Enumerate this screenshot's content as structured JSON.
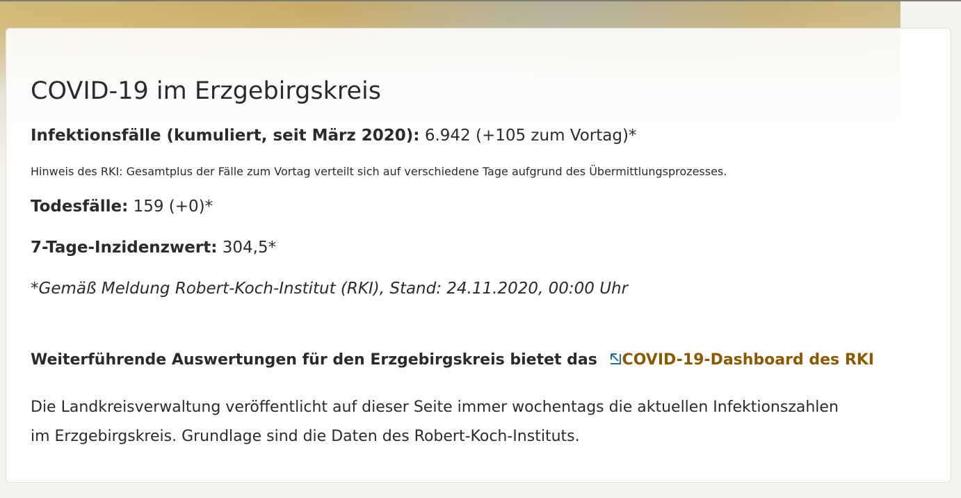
{
  "heading": "COVID-19 im Erzgebirgskreis",
  "infections": {
    "label": "Infektionsfälle (kumuliert, seit März 2020):",
    "value": "6.942 (+105 zum Vortag)*"
  },
  "rki_note": "Hinweis des RKI: Gesamtplus der Fälle zum Vortag verteilt sich auf verschiedene Tage aufgrund des Übermittlungsprozesses.",
  "deaths": {
    "label": "Todesfälle:",
    "value": "159 (+0)*"
  },
  "incidence": {
    "label": "7-Tage-Inzidenzwert:",
    "value": "304,5*"
  },
  "source_note": "*Gemäß Meldung Robert-Koch-Institut (RKI), Stand: 24.11.2020, 00:00 Uhr",
  "further": {
    "text": "Weiterführende Auswertungen für den Erzgebirgskreis bietet das",
    "link_label": "COVID-19-Dashboard des RKI",
    "icon": "external-link-icon",
    "link_color": "#8a5a00"
  },
  "description": "Die Landkreisverwaltung veröffentlicht auf dieser Seite immer wochentags die aktuellen Infektionszahlen im Erzgebirgskreis. Grundlage sind die Daten des Robert-Koch-Instituts."
}
